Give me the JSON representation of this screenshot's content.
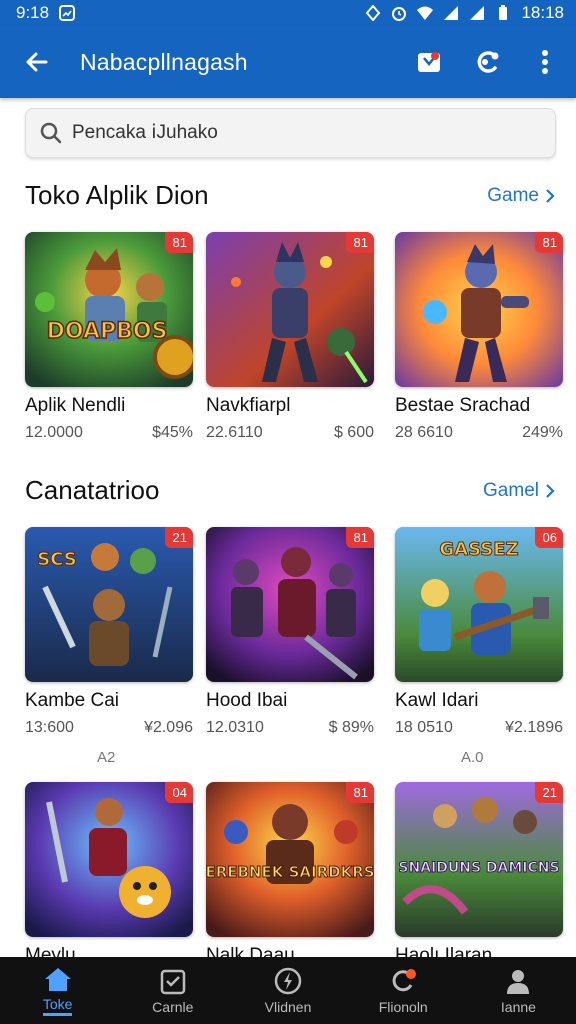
{
  "status_bar": {
    "time_left": "9:18",
    "time_right": "18:18"
  },
  "app_bar": {
    "title": "Nabacpllnagash"
  },
  "search": {
    "placeholder": "Pencaka ⅰJuhako"
  },
  "sections": [
    {
      "title": "Toko Alplik Dion",
      "link": "Game",
      "cards": [
        {
          "name": "Aplik Nendli",
          "downloads": "12.0000",
          "price": "$45%",
          "badge": "81",
          "art_text": "DOAPBOS"
        },
        {
          "name": "Navkfiarpl",
          "downloads": "22.6110",
          "price": "$ 600",
          "badge": "81",
          "art_text": ""
        },
        {
          "name": "Bestae Srachad",
          "downloads": "28 6610",
          "price": "249%",
          "badge": "81",
          "art_text": ""
        }
      ]
    },
    {
      "title": "Canatatrioo",
      "link": "Gamel",
      "cards": [
        {
          "name": "Kambe Cai",
          "downloads": "13:600",
          "price": "¥2.096",
          "badge": "21",
          "art_text": "SCS",
          "sub": "A2"
        },
        {
          "name": "Hood Ibai",
          "downloads": "12.0310",
          "price": "$ 89%",
          "badge": "81",
          "art_text": ""
        },
        {
          "name": "Kawl Idari",
          "downloads": "18 0510",
          "price": "¥2.1896",
          "badge": "06",
          "art_text": "GASSEZ",
          "sub": "A.0"
        }
      ]
    },
    {
      "cards": [
        {
          "name": "Meylu",
          "badge": "04",
          "art_text": ""
        },
        {
          "name": "Nalk Daau",
          "badge": "81",
          "art_text": "EREBNEK SAIRDKRS"
        },
        {
          "name": "Haolı Ilaran",
          "badge": "21",
          "art_text": "SNAIDUNS DAMICNS"
        }
      ]
    }
  ],
  "bottom_nav": [
    {
      "label": "Toke",
      "icon": "home-icon",
      "active": true
    },
    {
      "label": "Carnle",
      "icon": "calendar-icon",
      "active": false
    },
    {
      "label": "Vlidnen",
      "icon": "lightning-icon",
      "active": false
    },
    {
      "label": "Flionoln",
      "icon": "refresh-icon",
      "active": false
    },
    {
      "label": "Ianne",
      "icon": "person-icon",
      "active": false
    }
  ],
  "colors": {
    "primary": "#1565c0",
    "badge": "#e53935",
    "link": "#1e73d8",
    "nav_active": "#4ea1ff"
  }
}
